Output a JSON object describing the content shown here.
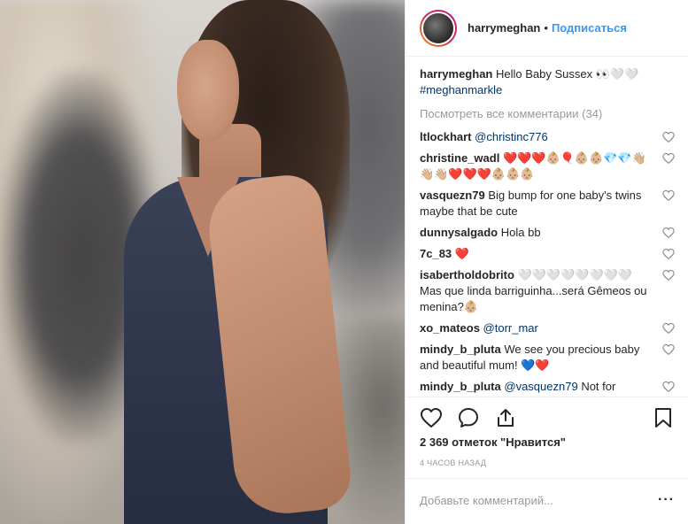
{
  "header": {
    "username": "harrymeghan",
    "separator": "•",
    "follow_label": "Подписаться"
  },
  "caption": {
    "username": "harrymeghan",
    "text": "Hello Baby Sussex 👀🤍🤍",
    "hashtag": "#meghanmarkle"
  },
  "view_all": "Посмотреть все комментарии (34)",
  "comments": [
    {
      "username": "ltlockhart",
      "text": "",
      "mention": "@christinc776"
    },
    {
      "username": "christine_wadl",
      "text": "❤️❤️❤️👶🏼🎈👶🏼👶🏼💎💎👋🏼👋🏼👋🏼❤️❤️❤️👶🏼👶🏼👶🏼",
      "mention": ""
    },
    {
      "username": "vasquezn79",
      "text": "Big bump for one baby's twins maybe that be cute",
      "mention": ""
    },
    {
      "username": "dunnysalgado",
      "text": "Hola bb",
      "mention": ""
    },
    {
      "username": "7c_83",
      "text": "❤️",
      "mention": ""
    },
    {
      "username": "isabertholdobrito",
      "text": "🤍🤍🤍🤍🤍🤍🤍🤍Mas que linda barriguinha...será Gêmeos ou menina?👶🏼",
      "mention": ""
    },
    {
      "username": "xo_mateos",
      "text": "",
      "mention": "@torr_mar"
    },
    {
      "username": "mindy_b_pluta",
      "text": "We see you precious baby and beautiful mum! 💙❤️",
      "mention": ""
    },
    {
      "username": "mindy_b_pluta",
      "text": "Not for",
      "mention": "@vasquezn79"
    }
  ],
  "likes": "2 369 отметок \"Нравится\"",
  "timestamp": "4 ЧАСОВ НАЗАД",
  "add_comment": {
    "placeholder": "Добавьте комментарий...",
    "more": "···"
  },
  "colors": {
    "link_blue": "#3897f0",
    "hashtag_blue": "#003569",
    "muted": "#999999",
    "border": "#efefef"
  }
}
